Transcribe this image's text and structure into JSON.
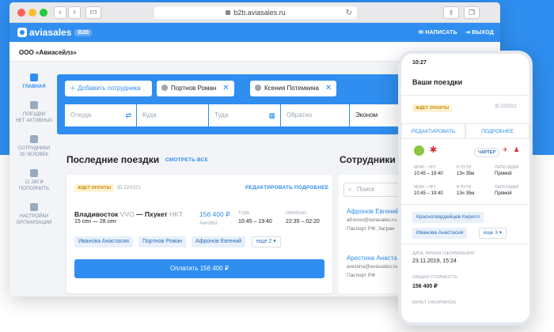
{
  "browser": {
    "url": "b2b.aviasales.ru"
  },
  "app": {
    "logo": "aviasales",
    "logo_badge": "B2B",
    "write_label": "НАПИСАТЬ",
    "logout_label": "ВЫХОД",
    "org_name": "ООО «Авиасейлз»"
  },
  "sidebar": {
    "items": [
      {
        "label": "ГЛАВНАЯ"
      },
      {
        "label": "ПОЕЗДКИ\nНЕТ АКТИВНЫХ"
      },
      {
        "label": "СОТРУДНИКИ\n26 ЧЕЛОВЕК"
      },
      {
        "label": "11 280 ₽\nПОПОЛНИТЬ"
      },
      {
        "label": "НАСТРОЙКИ\nОРГАНИЗАЦИИ"
      }
    ]
  },
  "search": {
    "add_employee": "Добавить сотрудника",
    "chips": [
      "Портнов Роман",
      "Ксения Потемкина"
    ],
    "from_placeholder": "Откуда",
    "to_placeholder": "Куда",
    "date_placeholder": "Туда",
    "back_placeholder": "Обратно",
    "class_value": "Эконом"
  },
  "trips": {
    "heading": "Последние поездки",
    "see_all": "СМОТРЕТЬ ВСЕ",
    "card": {
      "status": "ЖДЕТ ОПЛАТЫ",
      "id": "ID 220321",
      "edit": "РЕДАКТИРОВАТЬ",
      "details": "ПОДРОБНЕЕ",
      "from_city": "Владивосток",
      "from_code": "VVO",
      "arrow": "—",
      "to_city": "Пхукет",
      "to_code": "HKT",
      "dates": "15 сен — 28 сен",
      "price": "156 400 ₽",
      "airline": "Aeroflot",
      "there_label": "ТУДА",
      "there_time": "10:45 – 19:40",
      "back_label": "ОБРАТНО",
      "back_time": "22:35 – 02:20",
      "passengers": [
        "Иванова Анастасия",
        "Портнов Роман",
        "Афронов Евгений"
      ],
      "more": "еще 2 ▾",
      "pay_label": "Оплатить 156 400 ₽"
    }
  },
  "employees": {
    "heading": "Сотрудники",
    "search_placeholder": "Поиск",
    "list": [
      {
        "name": "Афронов Евгений",
        "email": "afronov@aviasales.ru",
        "doc": "Паспорт РФ, Загран"
      },
      {
        "name": "Арестина Анаста",
        "email": "arestina@aviasales.ru",
        "doc": "Паспорт РФ"
      }
    ]
  },
  "phone": {
    "time": "10:27",
    "title": "Ваши поездки",
    "status": "ЖДЕТ ОПЛАТЫ",
    "id": "ID 220321",
    "edit": "РЕДАКТИРОВАТЬ",
    "details": "ПОДРОБНЕЕ",
    "charter": "ЧАРТЕР",
    "segments": [
      {
        "route": "МОW – НКТ",
        "time": "10:45 – 19:40",
        "duration_label": "В ПУТИ",
        "duration": "13ч 35м",
        "transfer_label": "ПЕРЕСАДКИ",
        "transfer": "Прямой"
      },
      {
        "route": "МОW – НКТ",
        "time": "10:45 – 19:40",
        "duration_label": "В ПУТИ",
        "duration": "13ч 35м",
        "transfer_label": "ПЕРЕСАДКИ",
        "transfer": "Прямой"
      }
    ],
    "passengers": [
      "Красногвардейцев Кирилл",
      "Иванова Анастасия"
    ],
    "more": "еще 3 ▾",
    "date_label": "ДАТА, ВРЕМЯ ОФОРМЛЕНИЯ",
    "date_value": "23.11.2019, 15:24",
    "cost_label": "ОБЩАЯ СТОИМОСТЬ",
    "cost_value": "156 400 ₽",
    "ticket_label": "БИЛЕТ ОФОРМИЛ(А)"
  },
  "colors": {
    "brand": "#2f8ef0",
    "status_warning": "#c48a00"
  }
}
